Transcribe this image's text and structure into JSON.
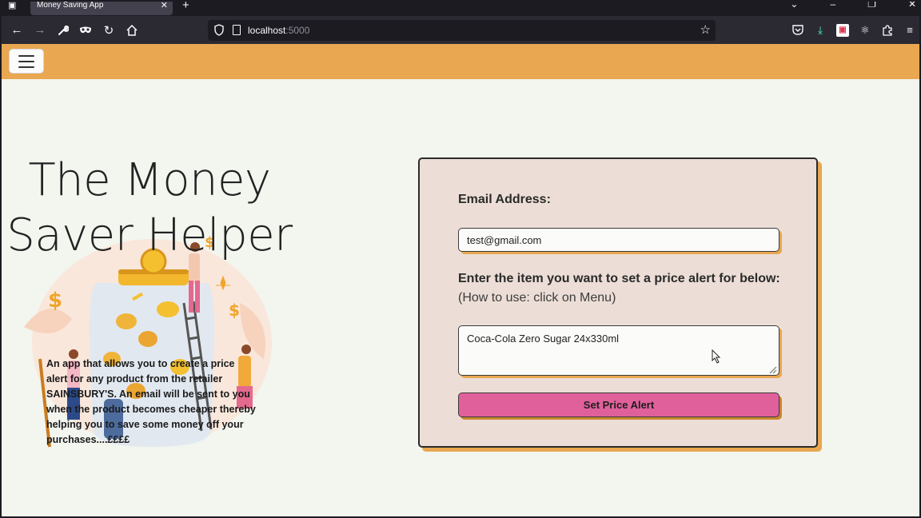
{
  "browser": {
    "tab_title": "Money Saving App",
    "url_host": "localhost",
    "url_port": ":5000"
  },
  "icons": {
    "tab_list": "tab-list-icon",
    "close_tab": "close-icon",
    "new_tab": "plus-icon",
    "back": "arrow-left-icon",
    "forward": "arrow-right-icon",
    "tools": "wrench-icon",
    "private": "mask-icon",
    "reload": "reload-icon",
    "home": "home-icon",
    "bookmark": "star-icon",
    "pocket": "pocket-icon",
    "downloads": "download-icon",
    "menu": "hamburger-icon"
  },
  "colors": {
    "accent": "#e8a750",
    "button": "#e0609b",
    "card": "#ecded7",
    "page": "#f3f5ef"
  },
  "hero": {
    "title": "The Money Saver Helper",
    "description": "An app that allows you to create a price alert for any product from the retailer SAINSBURY'S. An email will be sent to you when the product becomes cheaper thereby helping you to save some money off your purchases....££££"
  },
  "form": {
    "email_label": "Email Address:",
    "email_value": "test@gmail.com",
    "item_label": "Enter the item you want to set a price alert for below:",
    "item_hint": "(How to use: click on Menu)",
    "item_value": "Coca-Cola Zero Sugar 24x330ml",
    "submit_label": "Set Price Alert"
  }
}
